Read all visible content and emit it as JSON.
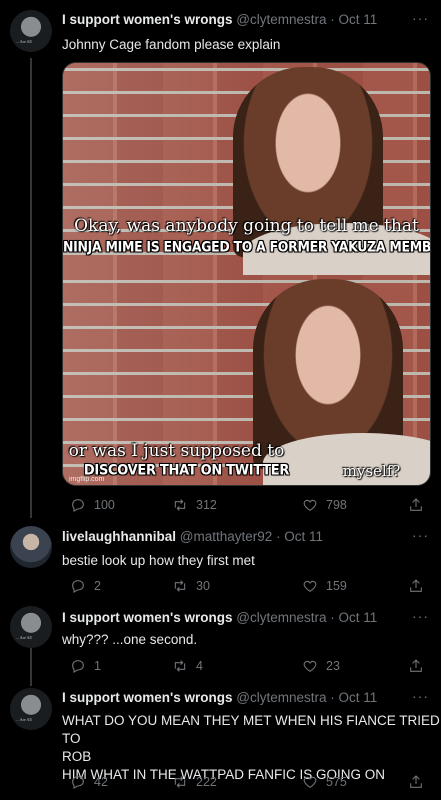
{
  "tweets": [
    {
      "name": "I support women's wrongs",
      "handle": "@clytemnestra",
      "date": "Oct 11",
      "text_lines": [
        "Johnny Cage fandom please explain"
      ],
      "media": {
        "panel1_line1": "Okay, was anybody going to tell me that",
        "panel1_line2": "NINJA MIME IS ENGAGED TO A FORMER YAKUZA MEMBER",
        "panel2_line1": "or was I just supposed to",
        "panel2_line2": "DISCOVER THAT ON TWITTER",
        "panel2_line3": "myself?",
        "watermark": "imgflip.com"
      },
      "replies": "100",
      "retweets": "312",
      "likes": "798"
    },
    {
      "name": "livelaughhannibal",
      "handle": "@matthayter92",
      "date": "Oct 11",
      "text_lines": [
        "bestie look up how they first met"
      ],
      "replies": "2",
      "retweets": "30",
      "likes": "159"
    },
    {
      "name": "I support women's wrongs",
      "handle": "@clytemnestra",
      "date": "Oct 11",
      "text_lines": [
        "why??? ...one second."
      ],
      "replies": "1",
      "retweets": "4",
      "likes": "23"
    },
    {
      "name": "I support women's wrongs",
      "handle": "@clytemnestra",
      "date": "Oct 11",
      "text_lines": [
        "WHAT DO YOU MEAN THEY MET WHEN HIS FIANCE TRIED TO",
        "ROB",
        "HIM WHAT IN THE WATTPAD FANFIC IS GOING ON"
      ],
      "replies": "42",
      "retweets": "222",
      "likes": "575"
    }
  ],
  "more_label": "···",
  "separator": " · ",
  "avatar_caption": "... Are All"
}
